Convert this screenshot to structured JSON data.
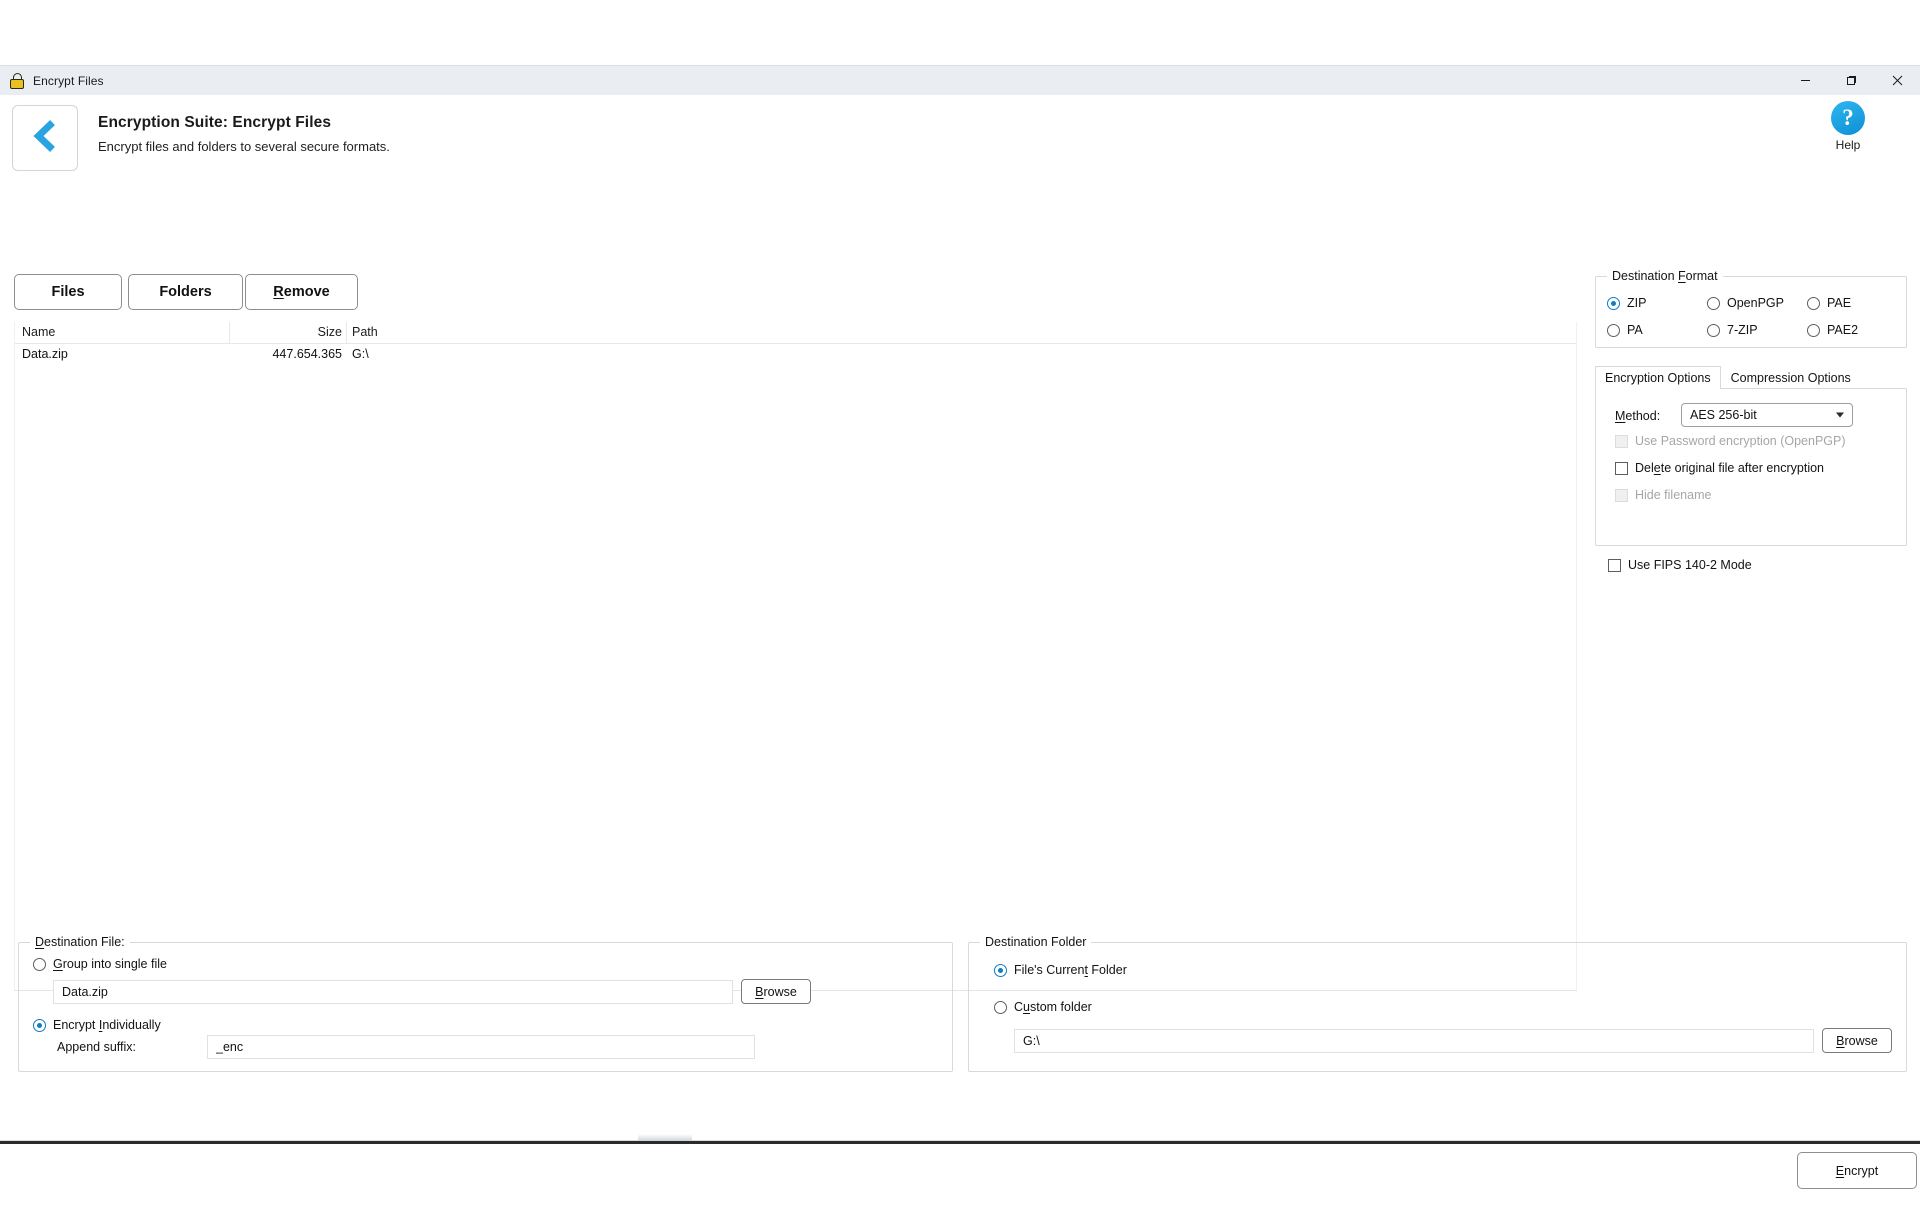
{
  "window": {
    "title": "Encrypt Files",
    "icon": "padlock-icon",
    "minimize_label": "Minimize",
    "maximize_label": "Maximize",
    "close_label": "Close"
  },
  "header": {
    "back_icon": "back-chevron-icon",
    "title": "Encryption Suite: Encrypt Files",
    "subtitle": "Encrypt files and folders to several secure formats.",
    "help_glyph": "?",
    "help_label": "Help"
  },
  "toolbar": {
    "files_label": "Files",
    "folders_label": "Folders",
    "remove_label": "Remove",
    "remove_accel": "R"
  },
  "file_list": {
    "columns": [
      "Name",
      "Size",
      "Path"
    ],
    "rows": [
      {
        "name": "Data.zip",
        "size": "447.654.365",
        "path": "G:\\"
      }
    ]
  },
  "destination_format": {
    "legend": "Destination Format",
    "legend_pre": "Destination ",
    "legend_accel": "F",
    "legend_post": "ormat",
    "options": [
      {
        "label": "ZIP",
        "selected": true
      },
      {
        "label": "OpenPGP",
        "selected": false
      },
      {
        "label": "PAE",
        "selected": false
      },
      {
        "label": "PA",
        "selected": false
      },
      {
        "label": "7-ZIP",
        "selected": false
      },
      {
        "label": "PAE2",
        "selected": false
      }
    ]
  },
  "options_tabs": {
    "tabs": [
      {
        "label": "Encryption Options",
        "active": true
      },
      {
        "label": "Compression Options",
        "active": false
      }
    ],
    "method_label_pre": "",
    "method_label_accel": "M",
    "method_label_post": "ethod:",
    "method_value": "AES 256-bit",
    "checkboxes": [
      {
        "label": "Use Password encryption (OpenPGP)",
        "checked": false,
        "disabled": true
      },
      {
        "label": "Delete original file after encryption",
        "checked": false,
        "disabled": false,
        "accel_index": 5
      },
      {
        "label": "Hide filename",
        "checked": false,
        "disabled": true
      }
    ]
  },
  "fips": {
    "label": "Use FIPS 140-2 Mode",
    "checked": false
  },
  "destination_file": {
    "legend": "Destination File:",
    "legend_accel": "D",
    "legend_rest": "estination File:",
    "group_option": {
      "label": "Group into single file",
      "accel": "G",
      "rest": "roup into single file",
      "selected": false
    },
    "filename_value": "Data.zip",
    "filename_placeholder": "",
    "browse_label": "Browse",
    "browse_accel": "B",
    "browse_rest": "rowse",
    "individual_option": {
      "label": "Encrypt Individually",
      "selected": true
    },
    "suffix_label": "Append suffix:",
    "suffix_value": "_enc"
  },
  "destination_folder": {
    "legend": "Destination Folder",
    "current_option": {
      "label": "File's Current Folder",
      "selected": true
    },
    "custom_option": {
      "label": "Custom folder",
      "selected": false
    },
    "folder_value": "G:\\",
    "browse_label": "Browse"
  },
  "actions": {
    "encrypt_label": "Encrypt",
    "encrypt_accel": "E",
    "encrypt_rest": "ncrypt"
  },
  "colors": {
    "accent": "#0f7cc4",
    "titlebar": "#eaeef2",
    "help_blue": "#0d8fd6",
    "lock_gold": "#e8c01f"
  }
}
